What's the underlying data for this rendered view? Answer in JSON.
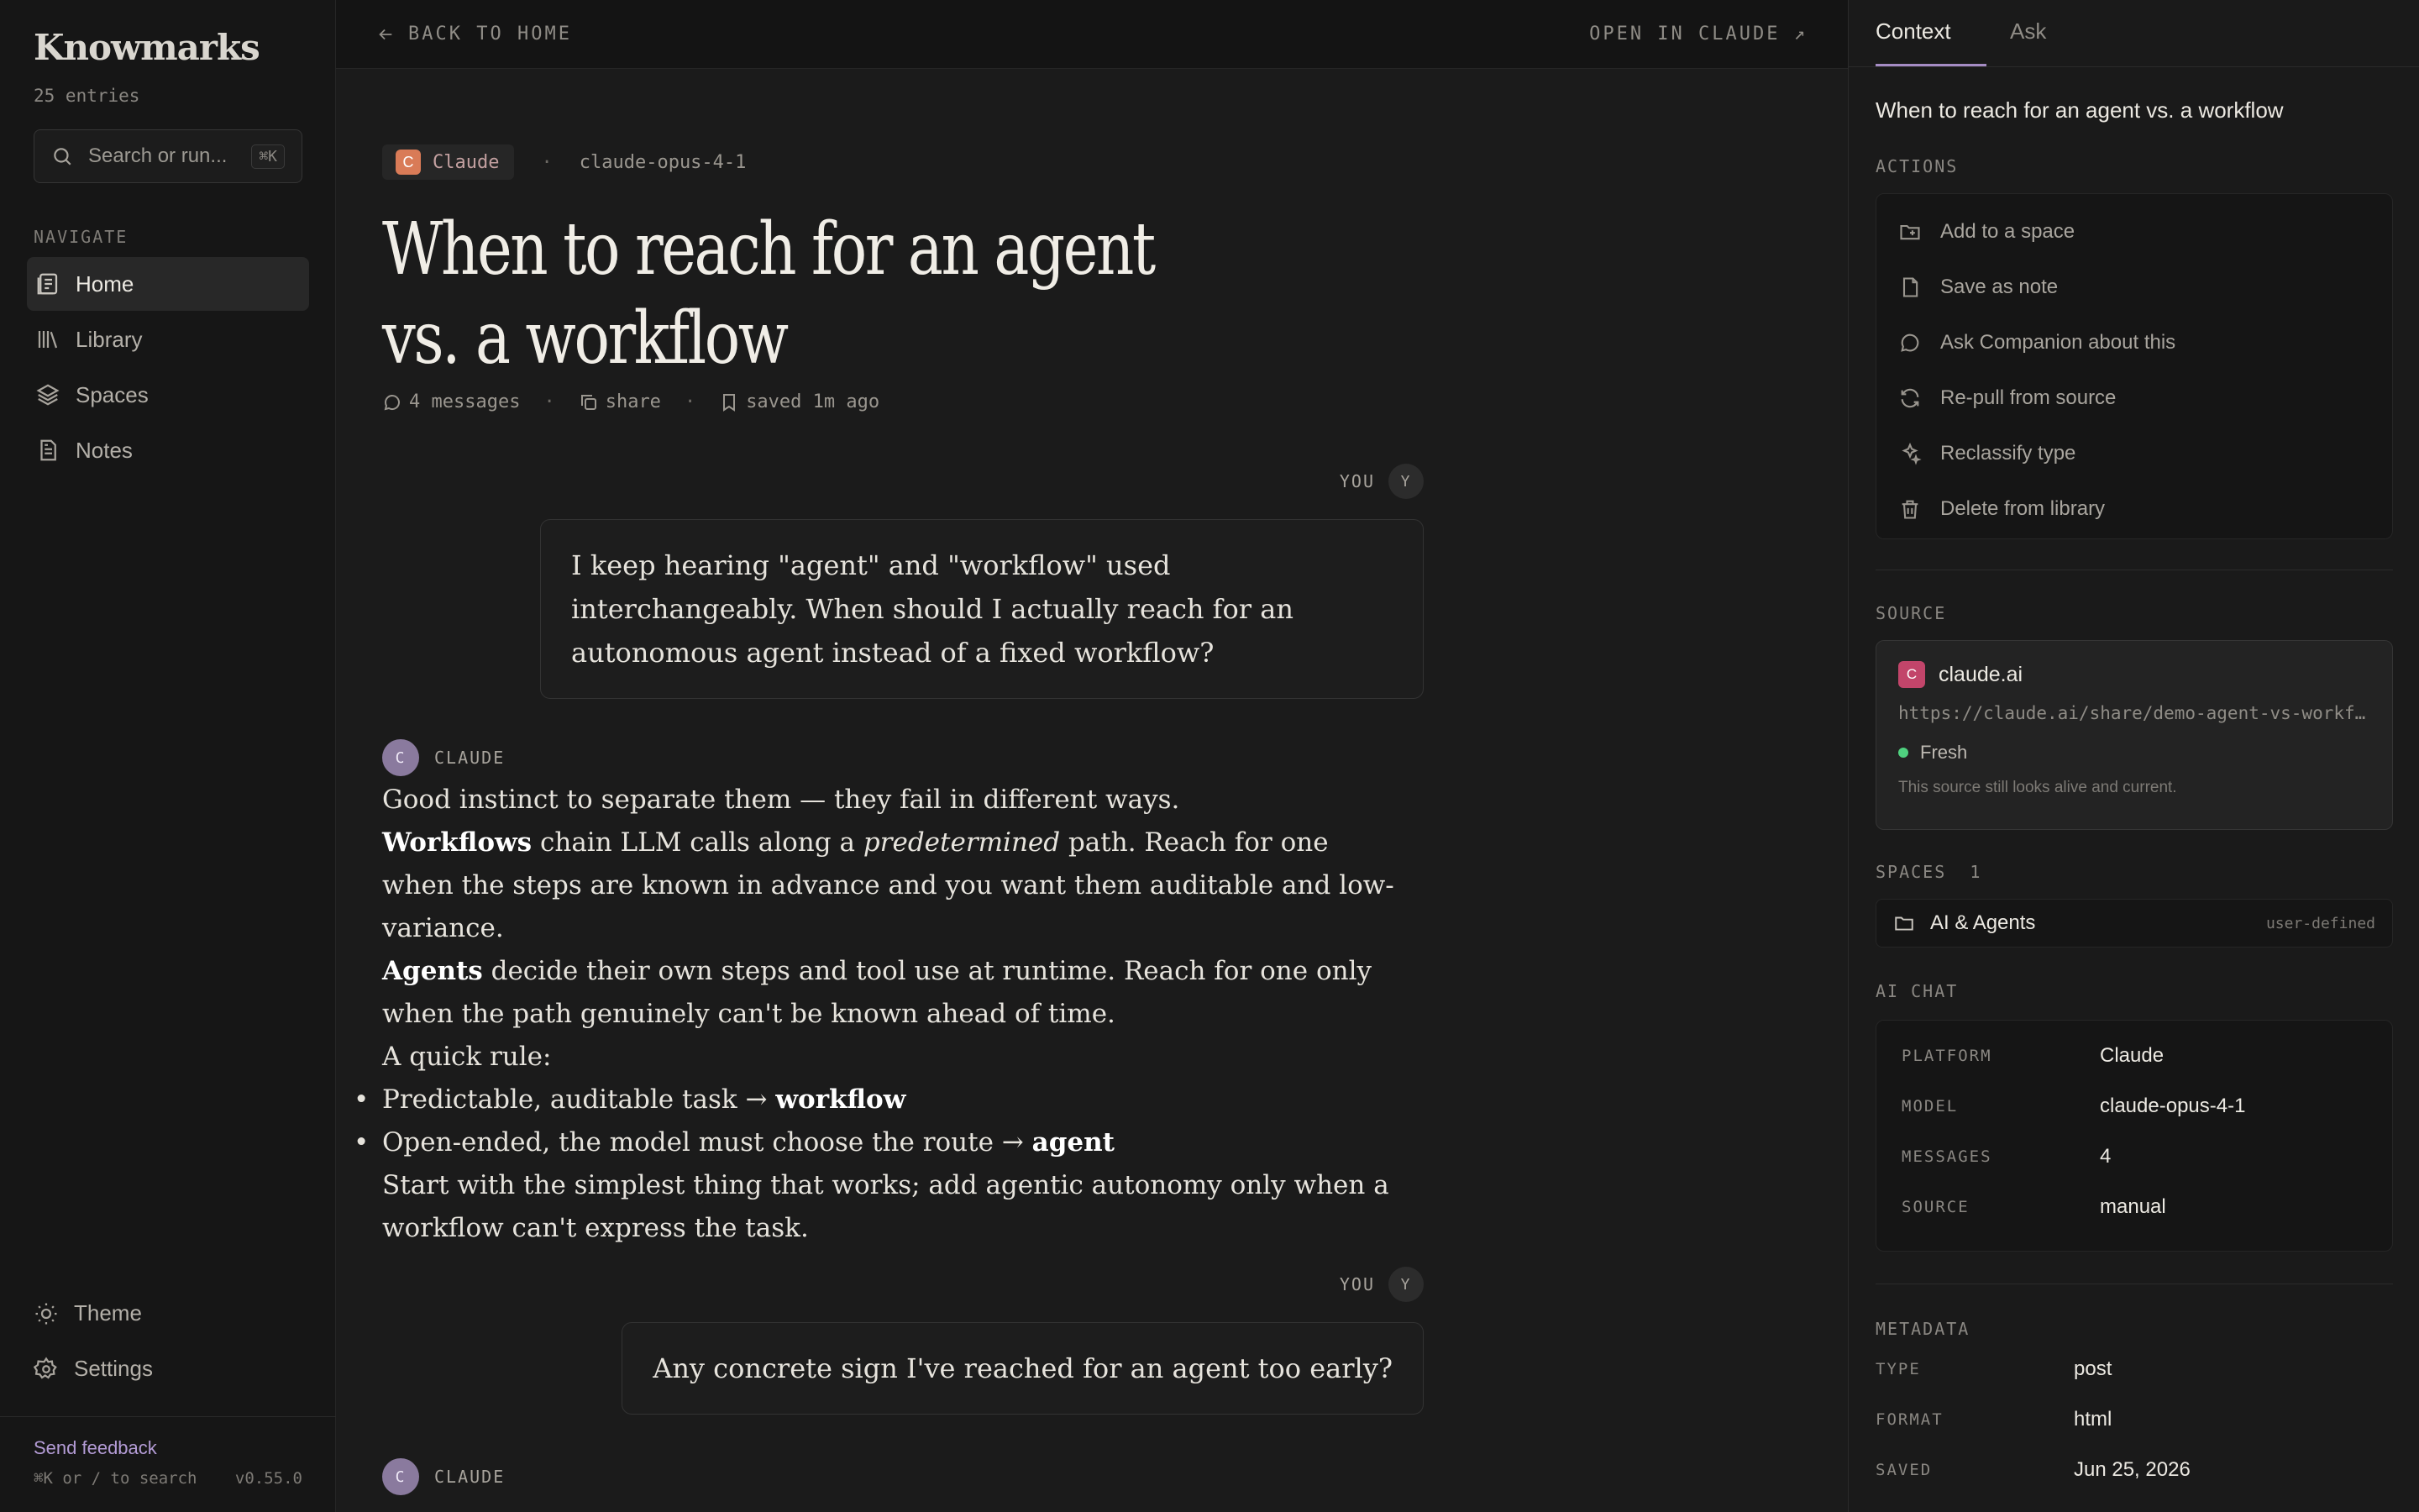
{
  "sidebar": {
    "logo": "Knowmarks",
    "entry_count": "25 entries",
    "search_placeholder": "Search or run...",
    "search_shortcut": "⌘K",
    "nav_label": "NAVIGATE",
    "nav_items": [
      {
        "label": "Home",
        "icon": "home-icon",
        "active": true
      },
      {
        "label": "Library",
        "icon": "library-icon",
        "active": false
      },
      {
        "label": "Spaces",
        "icon": "layers-icon",
        "active": false
      },
      {
        "label": "Notes",
        "icon": "note-icon",
        "active": false
      }
    ],
    "bottom_items": [
      {
        "label": "Theme",
        "icon": "sun-icon"
      },
      {
        "label": "Settings",
        "icon": "gear-icon"
      }
    ],
    "feedback": "Send feedback",
    "search_hint": "⌘K or / to search",
    "version": "v0.55.0"
  },
  "topbar": {
    "back": "BACK TO HOME",
    "open": "OPEN IN CLAUDE ↗"
  },
  "entry": {
    "platform": "Claude",
    "platform_initial": "C",
    "model": "claude-opus-4-1",
    "title": "When to reach for an agent vs. a workflow",
    "messages": "4 messages",
    "share": "share",
    "saved": "saved 1m ago"
  },
  "conversation": {
    "you_label": "YOU",
    "you_initial": "Y",
    "claude_label": "CLAUDE",
    "claude_initial": "C",
    "msg1": "I keep hearing \"agent\" and \"workflow\" used interchangeably. When should I actually reach for an autonomous agent instead of a fixed workflow?",
    "answer": {
      "intro": "Good instinct to separate them — they fail in different ways.",
      "workflows_term": "Workflows",
      "workflows_pre": " chain LLM calls along a ",
      "workflows_em": "predetermined",
      "workflows_post": " path. Reach for one when the steps are known in advance and you want them auditable and low-variance.",
      "agents_term": "Agents",
      "agents_text": " decide their own steps and tool use at runtime. Reach for one only when the path genuinely can't be known ahead of time.",
      "rule": "A quick rule:",
      "bullet1_text": "Predictable, auditable task → ",
      "bullet1_bold": "workflow",
      "bullet2_text": "Open-ended, the model must choose the route → ",
      "bullet2_bold": "agent",
      "closing": "Start with the simplest thing that works; add agentic autonomy only when a workflow can't express the task."
    },
    "msg2": "Any concrete sign I've reached for an agent too early?"
  },
  "panel": {
    "tabs": [
      "Context",
      "Ask"
    ],
    "title": "When to reach for an agent vs. a workflow",
    "actions_label": "ACTIONS",
    "actions": [
      {
        "label": "Add to a space",
        "icon": "folder-plus-icon"
      },
      {
        "label": "Save as note",
        "icon": "file-icon"
      },
      {
        "label": "Ask Companion about this",
        "icon": "chat-bubble-icon"
      },
      {
        "label": "Re-pull from source",
        "icon": "refresh-icon"
      },
      {
        "label": "Reclassify type",
        "icon": "sparkles-icon"
      },
      {
        "label": "Delete from library",
        "icon": "trash-icon"
      }
    ],
    "source_label": "SOURCE",
    "source": {
      "name": "claude.ai",
      "initial": "C",
      "url": "https://claude.ai/share/demo-agent-vs-workflow",
      "status": "Fresh",
      "status_color": "#4fd17f",
      "note": "This source still looks alive and current."
    },
    "spaces_label": "SPACES",
    "spaces_count": "1",
    "space": {
      "name": "AI & Agents",
      "tag": "user-defined"
    },
    "ai_chat_label": "AI CHAT",
    "ai_chat": [
      {
        "key": "PLATFORM",
        "value": "Claude"
      },
      {
        "key": "MODEL",
        "value": "claude-opus-4-1"
      },
      {
        "key": "MESSAGES",
        "value": "4"
      },
      {
        "key": "SOURCE",
        "value": "manual"
      }
    ],
    "metadata_label": "METADATA",
    "metadata": [
      {
        "key": "TYPE",
        "value": "post"
      },
      {
        "key": "FORMAT",
        "value": "html"
      },
      {
        "key": "SAVED",
        "value": "Jun 25, 2026"
      }
    ]
  },
  "colors": {
    "accent": "#a58cc4",
    "claude": "#d97b57",
    "source_red": "#c2456a"
  }
}
